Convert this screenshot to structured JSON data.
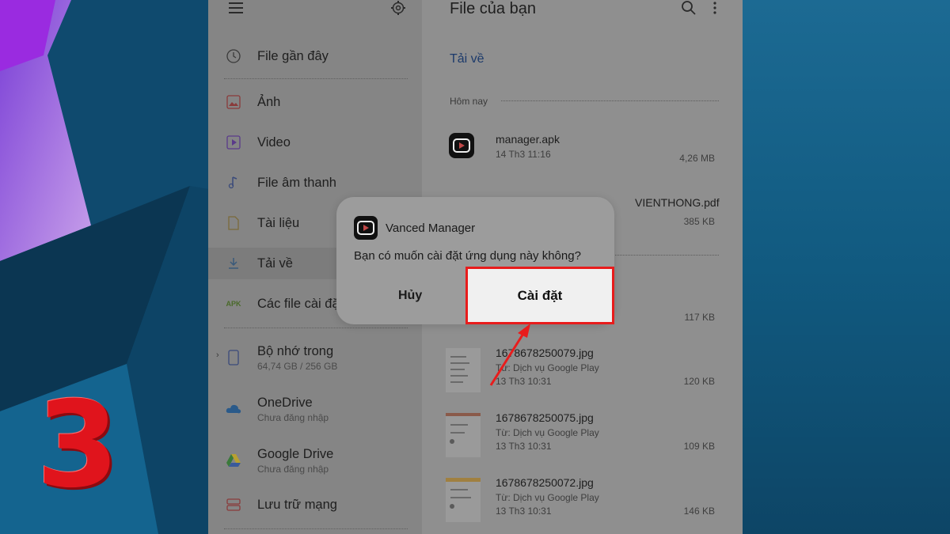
{
  "drawer": {
    "menu_icon": "hamburger-icon",
    "settings_icon": "gear-icon",
    "items": [
      {
        "label": "File gần đây",
        "icon": "clock-icon"
      },
      {
        "label": "Ảnh",
        "icon": "image-icon"
      },
      {
        "label": "Video",
        "icon": "video-icon"
      },
      {
        "label": "File âm thanh",
        "icon": "music-icon"
      },
      {
        "label": "Tài liệu",
        "icon": "document-icon"
      },
      {
        "label": "Tải về",
        "icon": "download-icon"
      },
      {
        "label": "Các file cài đặ",
        "icon": "apk-icon",
        "icon_text": "APK"
      }
    ],
    "storage": [
      {
        "label": "Bộ nhớ trong",
        "sub": "64,74 GB / 256 GB",
        "icon": "phone-icon"
      },
      {
        "label": "OneDrive",
        "sub": "Chưa đăng nhập",
        "icon": "onedrive-icon"
      },
      {
        "label": "Google Drive",
        "sub": "Chưa đăng nhập",
        "icon": "google-drive-icon"
      },
      {
        "label": "Lưu trữ mạng",
        "icon": "network-storage-icon"
      }
    ]
  },
  "main": {
    "title": "File của bạn",
    "search_icon": "search-icon",
    "more_icon": "more-vert-icon",
    "tab": "Tải về",
    "section": "Hôm nay",
    "files": [
      {
        "name": "manager.apk",
        "meta1": "14 Th3 11:16",
        "meta2": "",
        "size": "4,26 MB"
      },
      {
        "name": "VIENTHONG.pdf",
        "meta1": "",
        "meta2": "",
        "size": "385 KB"
      },
      {
        "name": "",
        "meta1": "",
        "meta2": "",
        "size": "117 KB"
      },
      {
        "name": "1678678250079.jpg",
        "meta1": "Từ: Dịch vụ Google Play",
        "meta2": "13 Th3 10:31",
        "size": "120 KB"
      },
      {
        "name": "1678678250075.jpg",
        "meta1": "Từ: Dịch vụ Google Play",
        "meta2": "13 Th3 10:31",
        "size": "109 KB"
      },
      {
        "name": "1678678250072.jpg",
        "meta1": "Từ: Dịch vụ Google Play",
        "meta2": "13 Th3 10:31",
        "size": "146 KB"
      }
    ]
  },
  "dialog": {
    "app_name": "Vanced Manager",
    "message": "Bạn có muốn cài đặt ứng dụng này không?",
    "cancel": "Hủy",
    "install": "Cài đặt"
  },
  "step_number": "3",
  "colors": {
    "highlight": "#e81c1c",
    "step_number": "#e0141c"
  }
}
